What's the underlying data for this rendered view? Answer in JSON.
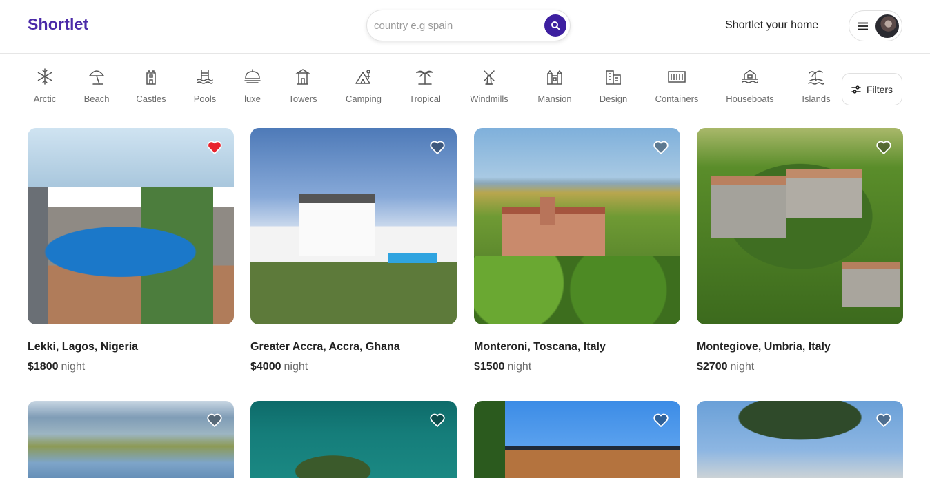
{
  "header": {
    "logo": "Shortlet",
    "search_placeholder": "country e.g spain",
    "host_link": "Shortlet your home"
  },
  "categories": [
    {
      "label": "Arctic",
      "icon": "snowflake-icon"
    },
    {
      "label": "Beach",
      "icon": "beach-umbrella-icon"
    },
    {
      "label": "Castles",
      "icon": "castle-icon"
    },
    {
      "label": "Pools",
      "icon": "pool-icon"
    },
    {
      "label": "luxe",
      "icon": "cloche-icon"
    },
    {
      "label": "Towers",
      "icon": "tower-icon"
    },
    {
      "label": "Camping",
      "icon": "tent-icon"
    },
    {
      "label": "Tropical",
      "icon": "palm-tree-icon"
    },
    {
      "label": "Windmills",
      "icon": "windmill-icon"
    },
    {
      "label": "Mansion",
      "icon": "mansion-icon"
    },
    {
      "label": "Design",
      "icon": "building-icon"
    },
    {
      "label": "Containers",
      "icon": "container-icon"
    },
    {
      "label": "Houseboats",
      "icon": "houseboat-icon"
    },
    {
      "label": "Islands",
      "icon": "island-icon"
    }
  ],
  "filters_label": "Filters",
  "listings": [
    {
      "location": "Lekki, Lagos, Nigeria",
      "price": "$1800",
      "unit": "night",
      "favorited": true
    },
    {
      "location": "Greater Accra, Accra, Ghana",
      "price": "$4000",
      "unit": "night",
      "favorited": false
    },
    {
      "location": "Monteroni, Toscana, Italy",
      "price": "$1500",
      "unit": "night",
      "favorited": false
    },
    {
      "location": "Montegiove, Umbria, Italy",
      "price": "$2700",
      "unit": "night",
      "favorited": false
    },
    {
      "favorited": false
    },
    {
      "favorited": false
    },
    {
      "favorited": false
    },
    {
      "favorited": false
    }
  ],
  "colors": {
    "brand": "#4b2aa8",
    "search_button": "#3d1fa0",
    "favorite": "#e8242f"
  }
}
